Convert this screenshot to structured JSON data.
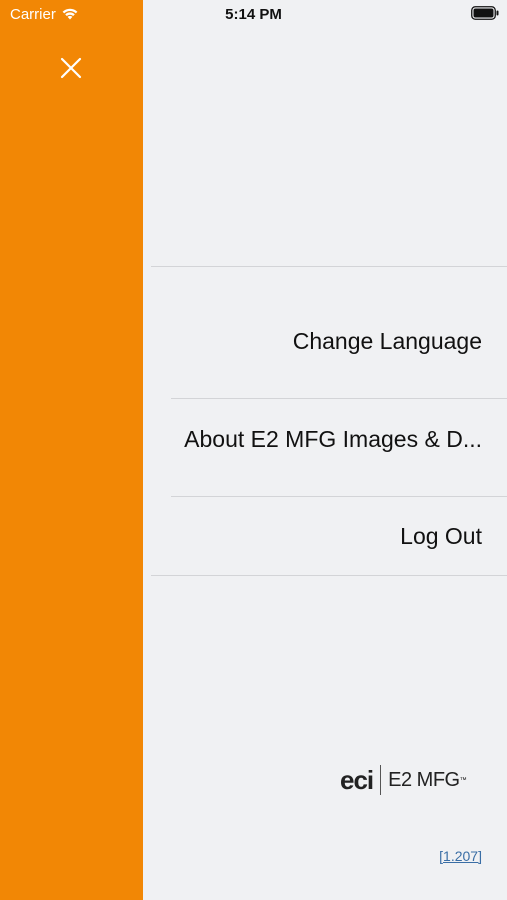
{
  "status_bar": {
    "carrier": "Carrier",
    "time": "5:14 PM",
    "wifi_icon": "wifi-icon",
    "battery_icon": "battery-icon"
  },
  "side_panel": {
    "accent_color": "#f28705",
    "close_icon": "close-icon"
  },
  "menu": {
    "items": [
      {
        "label": "Change Language"
      },
      {
        "label": "About E2 MFG Images & D..."
      },
      {
        "label": "Log Out"
      }
    ]
  },
  "logo": {
    "brand": "eci",
    "product": "E2 MFG",
    "trademark": "™"
  },
  "version": "[1.207]"
}
